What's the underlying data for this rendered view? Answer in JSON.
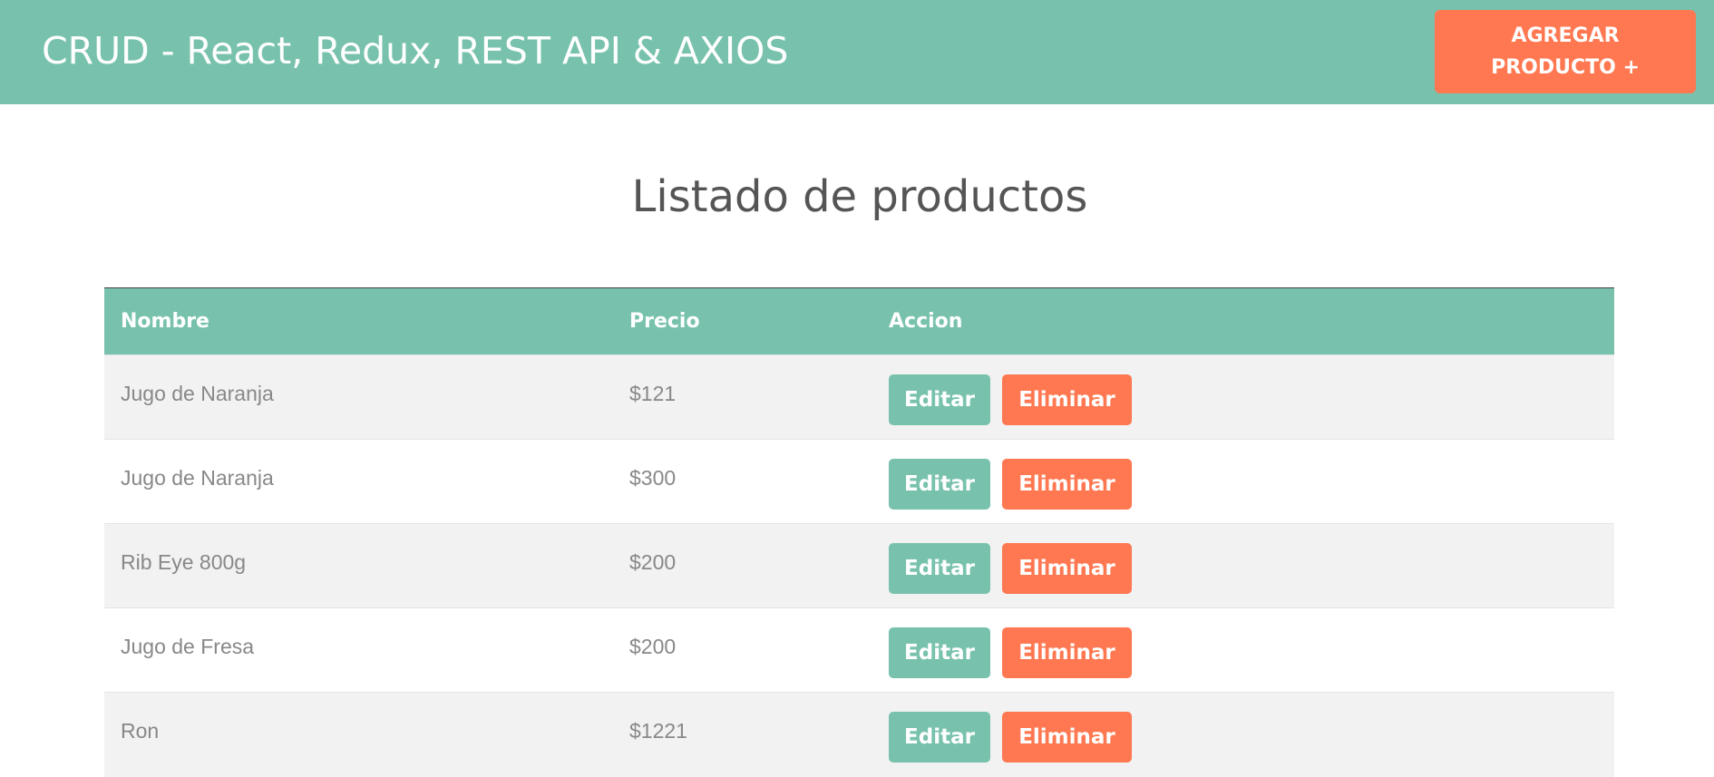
{
  "header": {
    "brand": "CRUD - React, Redux, REST API & AXIOS",
    "add_button_label": "AGREGAR PRODUCTO +"
  },
  "main": {
    "title": "Listado de productos",
    "table": {
      "columns": [
        "Nombre",
        "Precio",
        "Accion"
      ],
      "rows": [
        {
          "name": "Jugo de Naranja",
          "price": "$121",
          "edit_label": "Editar",
          "delete_label": "Eliminar"
        },
        {
          "name": "Jugo de Naranja",
          "price": "$300",
          "edit_label": "Editar",
          "delete_label": "Eliminar"
        },
        {
          "name": "Rib Eye 800g",
          "price": "$200",
          "edit_label": "Editar",
          "delete_label": "Eliminar"
        },
        {
          "name": "Jugo de Fresa",
          "price": "$200",
          "edit_label": "Editar",
          "delete_label": "Eliminar"
        },
        {
          "name": "Ron",
          "price": "$1221",
          "edit_label": "Editar",
          "delete_label": "Eliminar"
        }
      ]
    }
  },
  "colors": {
    "primary": "#78c2ad",
    "danger": "#ff7851",
    "text": "#888888",
    "heading": "#555555"
  }
}
